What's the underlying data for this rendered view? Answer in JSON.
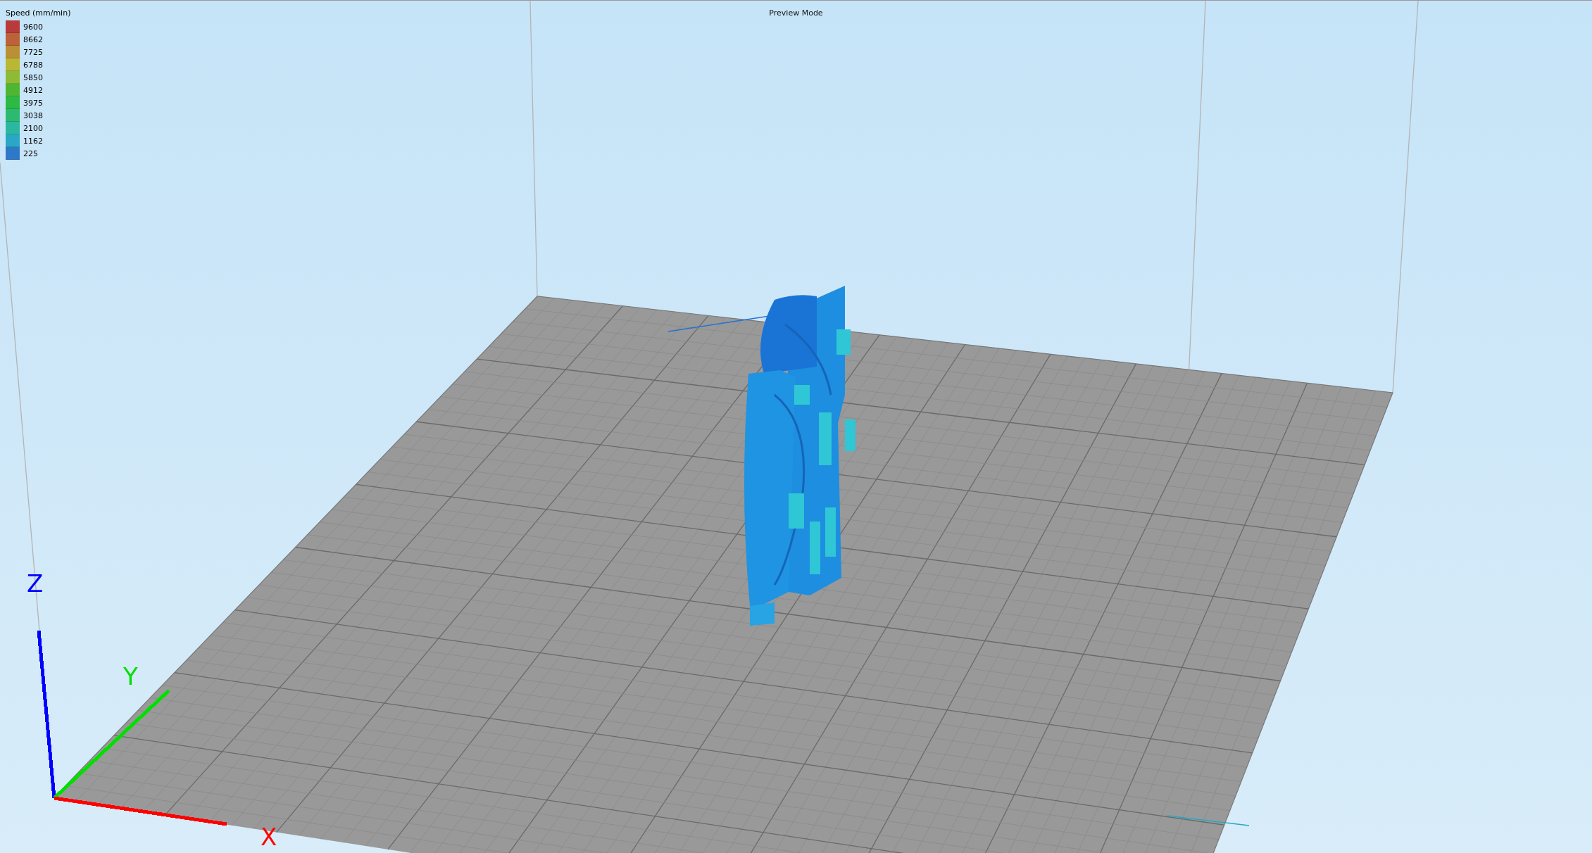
{
  "title": "Preview Mode",
  "legend": {
    "title": "Speed (mm/min)",
    "items": [
      {
        "label": "9600",
        "color": "#b83a3a"
      },
      {
        "label": "8662",
        "color": "#bb6238"
      },
      {
        "label": "7725",
        "color": "#bb8f35"
      },
      {
        "label": "6788",
        "color": "#b8b834"
      },
      {
        "label": "5850",
        "color": "#8dbb35"
      },
      {
        "label": "4912",
        "color": "#4fb633"
      },
      {
        "label": "3975",
        "color": "#2cb944"
      },
      {
        "label": "3038",
        "color": "#2bba70"
      },
      {
        "label": "2100",
        "color": "#2cb8a0"
      },
      {
        "label": "1162",
        "color": "#2aa7c4"
      },
      {
        "label": "225",
        "color": "#2e78c8"
      }
    ]
  },
  "axes": [
    {
      "label": "Z",
      "color": "#0000ff"
    },
    {
      "label": "Y",
      "color": "#00e000"
    },
    {
      "label": "X",
      "color": "#ff0000"
    }
  ]
}
